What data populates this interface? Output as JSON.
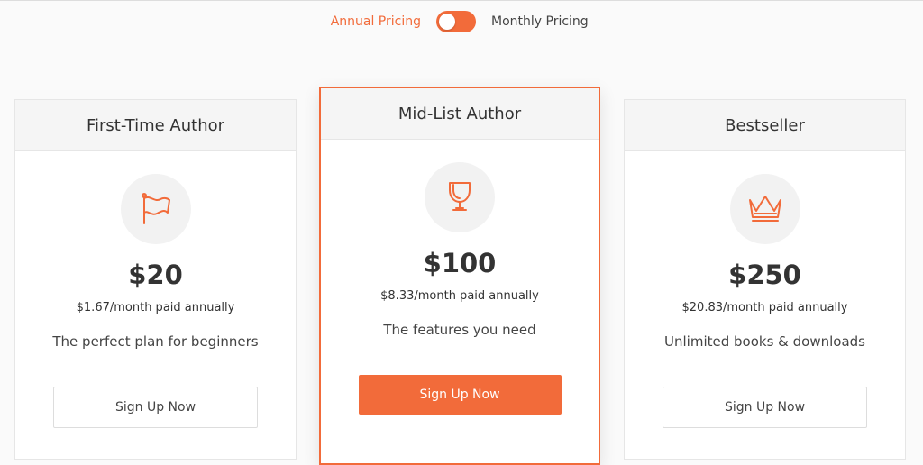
{
  "pricing_toggle": {
    "annual_label": "Annual Pricing",
    "monthly_label": "Monthly Pricing",
    "selected": "Annual Pricing"
  },
  "plans": [
    {
      "title": "First-Time Author",
      "icon": "flag-icon",
      "price": "$20",
      "per_month": "$1.67/month paid annually",
      "tagline": "The perfect plan for beginners",
      "cta": "Sign Up Now"
    },
    {
      "title": "Mid-List Author",
      "icon": "trophy-icon",
      "price": "$100",
      "per_month": "$8.33/month paid annually",
      "tagline": "The features you need",
      "cta": "Sign Up Now"
    },
    {
      "title": "Bestseller",
      "icon": "crown-icon",
      "price": "$250",
      "per_month": "$20.83/month paid annually",
      "tagline": "Unlimited books & downloads",
      "cta": "Sign Up Now"
    }
  ],
  "colors": {
    "accent": "#f26b3a",
    "card_header_bg": "#f5f5f5",
    "icon_circle_bg": "#f2f2f2"
  }
}
